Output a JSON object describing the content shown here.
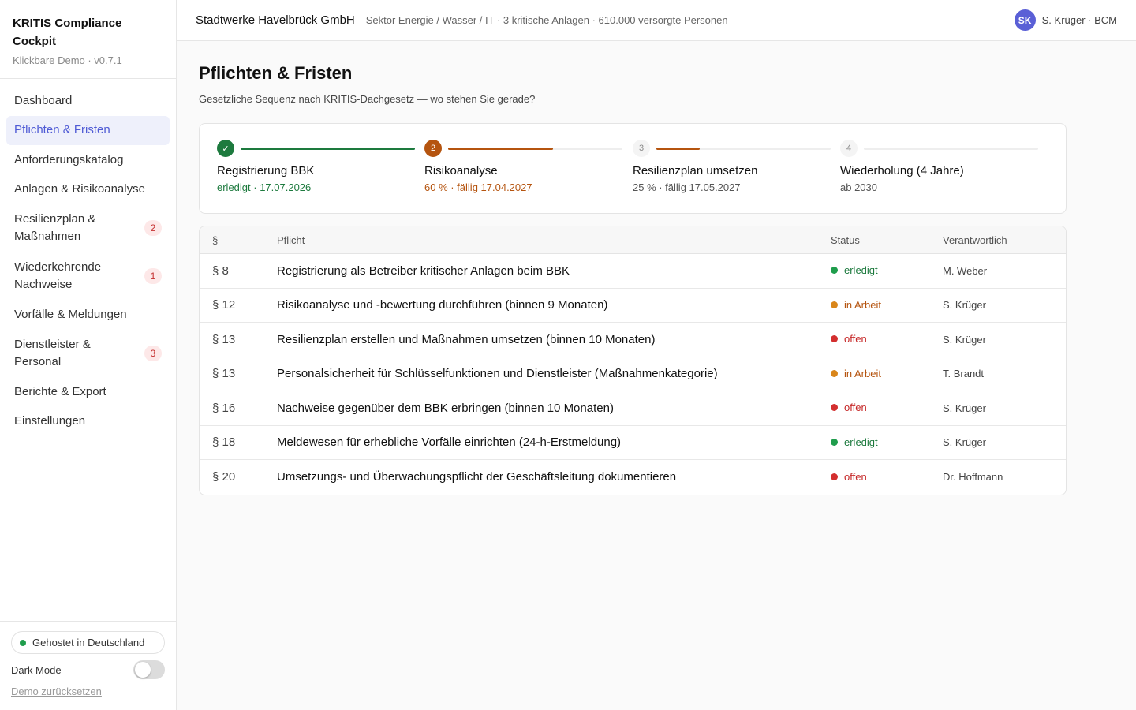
{
  "app": {
    "title": "KRITIS Compliance Cockpit",
    "subtitle": "Klickbare Demo · v0.7.1"
  },
  "sidebar": {
    "items": [
      {
        "label": "Dashboard",
        "badge": null
      },
      {
        "label": "Pflichten & Fristen",
        "badge": null,
        "active": true
      },
      {
        "label": "Anforderungskatalog",
        "badge": null
      },
      {
        "label": "Anlagen & Risikoanalyse",
        "badge": null
      },
      {
        "label": "Resilienzplan & Maßnahmen",
        "badge": "2"
      },
      {
        "label": "Wiederkehrende Nachweise",
        "badge": "1"
      },
      {
        "label": "Vorfälle & Meldungen",
        "badge": null
      },
      {
        "label": "Dienstleister & Personal",
        "badge": "3"
      },
      {
        "label": "Berichte & Export",
        "badge": null
      },
      {
        "label": "Einstellungen",
        "badge": null
      }
    ],
    "footer": {
      "hosted_label": "Gehostet in Deutschland",
      "darkmode_label": "Dark Mode",
      "darkmode_on": false,
      "reset_label": "Demo zurücksetzen"
    }
  },
  "topbar": {
    "org": "Stadtwerke Havelbrück GmbH",
    "sector": "Sektor Energie / Wasser / IT · 3 kritische Anlagen · 610.000 versorgte Personen",
    "user_initials": "SK",
    "user_label": "S. Krüger · BCM"
  },
  "page": {
    "title": "Pflichten & Fristen",
    "subtitle": "Gesetzliche Sequenz nach KRITIS-Dachgesetz — wo stehen Sie gerade?"
  },
  "steps": [
    {
      "marker": "✓",
      "name": "Registrierung BBK",
      "meta": "erledigt · 17.07.2026",
      "state": "done",
      "progress": 1.0
    },
    {
      "marker": "2",
      "name": "Risikoanalyse",
      "meta": "60 % · fällig 17.04.2027",
      "state": "active",
      "progress": 0.6
    },
    {
      "marker": "3",
      "name": "Resilienzplan umsetzen",
      "meta": "25 % · fällig 17.05.2027",
      "state": "pending",
      "progress": 0.25
    },
    {
      "marker": "4",
      "name": "Wiederholung (4 Jahre)",
      "meta": "ab 2030",
      "state": "pending",
      "progress": 0.0
    }
  ],
  "table": {
    "headers": {
      "paragraph": "§",
      "duty": "Pflicht",
      "status": "Status",
      "owner": "Verantwortlich"
    },
    "rows": [
      {
        "paragraph": "§ 8",
        "duty": "Registrierung als Betreiber kritischer Anlagen beim BBK",
        "status": "erledigt",
        "owner": "M. Weber"
      },
      {
        "paragraph": "§ 12",
        "duty": "Risikoanalyse und -bewertung durchführen (binnen 9 Monaten)",
        "status": "in Arbeit",
        "owner": "S. Krüger"
      },
      {
        "paragraph": "§ 13",
        "duty": "Resilienzplan erstellen und Maßnahmen umsetzen (binnen 10 Monaten)",
        "status": "offen",
        "owner": "S. Krüger"
      },
      {
        "paragraph": "§ 13",
        "duty": "Personalsicherheit für Schlüsselfunktionen und Dienstleister (Maßnahmenkategorie)",
        "status": "in Arbeit",
        "owner": "T. Brandt"
      },
      {
        "paragraph": "§ 16",
        "duty": "Nachweise gegenüber dem BBK erbringen (binnen 10 Monaten)",
        "status": "offen",
        "owner": "S. Krüger"
      },
      {
        "paragraph": "§ 18",
        "duty": "Meldewesen für erhebliche Vorfälle einrichten (24-h-Erstmeldung)",
        "status": "erledigt",
        "owner": "S. Krüger"
      },
      {
        "paragraph": "§ 20",
        "duty": "Umsetzungs- und Überwachungspflicht der Geschäftsleitung dokumentieren",
        "status": "offen",
        "owner": "Dr. Hoffmann"
      }
    ]
  },
  "colors": {
    "accent": "#4f5bd5",
    "done": "#1d7a3e",
    "in_progress": "#b5540f",
    "open": "#c62828",
    "done_dot": "#1f9d4c",
    "progress_dot": "#d9861a",
    "open_dot": "#d32f2f"
  }
}
